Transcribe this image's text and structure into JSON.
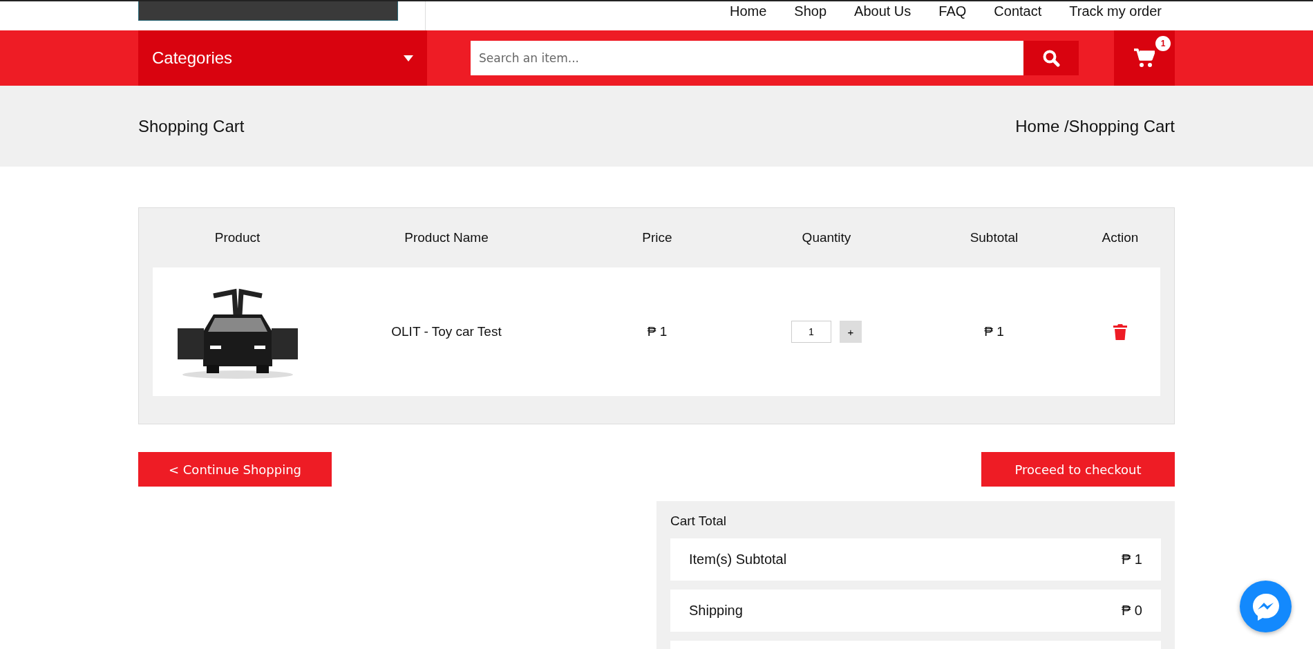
{
  "nav": [
    "Home",
    "Shop",
    "About Us",
    "FAQ",
    "Contact",
    "Track my order"
  ],
  "header": {
    "categories": "Categories",
    "search": {
      "placeholder": "Search an item..."
    },
    "cart_count": "1"
  },
  "page_title": "Shopping Cart",
  "breadcrumb": "Home /Shopping Cart",
  "cart": {
    "columns": [
      "Product",
      "Product Name",
      "Price",
      "Quantity",
      "Subtotal",
      "Action"
    ],
    "rows": [
      {
        "name": "OLIT - Toy car Test",
        "price": "₱ 1",
        "quantity": "1",
        "plus": "+",
        "subtotal": "₱ 1"
      }
    ]
  },
  "buttons": {
    "continue": "< Continue Shopping",
    "checkout": "Proceed to checkout"
  },
  "cart_total": {
    "title": "Cart Total",
    "rows": [
      {
        "label": "Item(s) Subtotal",
        "value": "₱ 1"
      },
      {
        "label": "Shipping",
        "value": "₱ 0"
      }
    ]
  }
}
